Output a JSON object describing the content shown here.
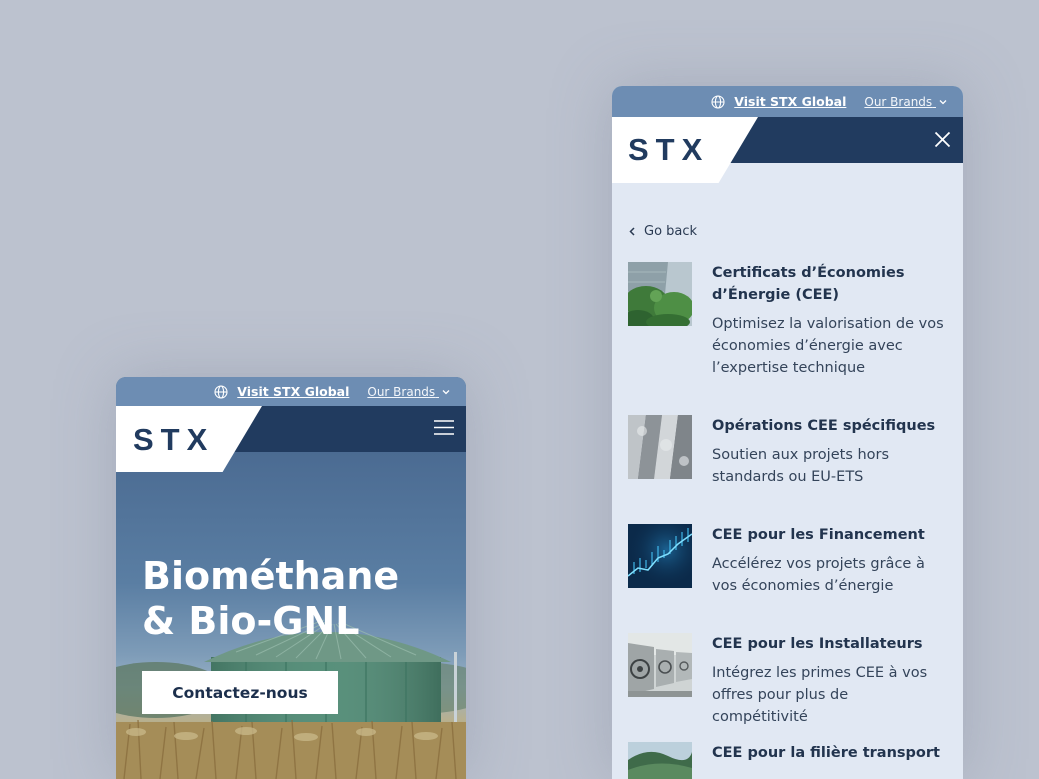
{
  "left_screen": {
    "topbar": {
      "visit_label": "Visit STX Global",
      "brands_label": "Our Brands"
    },
    "logo": "STX",
    "hero": {
      "title": "Biométhane & Bio-GNL",
      "cta_label": "Contactez-nous"
    },
    "icons": {
      "menu": "hamburger-icon",
      "globe": "globe-icon"
    }
  },
  "right_screen": {
    "topbar": {
      "visit_label": "Visit STX Global",
      "brands_label": "Our Brands"
    },
    "logo": "STX",
    "go_back": "Go back",
    "icons": {
      "close": "close-icon",
      "back": "chevron-left-icon"
    },
    "items": [
      {
        "title": "Certificats d’Économies d’Énergie (CEE)",
        "desc": "Optimisez la valorisation de vos économies d’énergie avec l’expertise technique"
      },
      {
        "title": "Opérations CEE spécifiques",
        "desc": "Soutien aux projets hors standards ou EU-ETS"
      },
      {
        "title": "CEE pour les Financement",
        "desc": "Accélérez vos projets grâce à vos économies d’énergie"
      },
      {
        "title": "CEE pour les Installateurs",
        "desc": "Intégrez les primes CEE à vos offres pour plus de compétitivité"
      },
      {
        "title": "CEE pour la filière transport",
        "desc": ""
      }
    ]
  },
  "colors": {
    "background": "#bcc2cf",
    "topbar": "#6d8db3",
    "navy": "#213b5f",
    "menu_panel": "#e1e8f3"
  }
}
